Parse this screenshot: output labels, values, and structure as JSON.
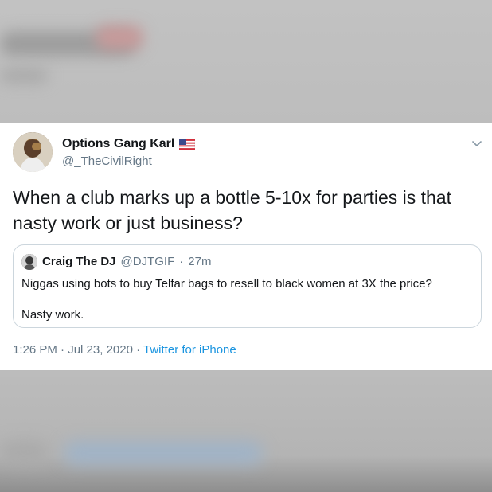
{
  "author": {
    "display_name": "Options Gang Karl",
    "handle": "@_TheCivilRight",
    "badge_icon": "us-flag-icon"
  },
  "tweet": {
    "text": "When a club marks up a bottle 5-10x for parties is that nasty work or just business?"
  },
  "quoted_tweet": {
    "display_name": "Craig The DJ",
    "handle": "@DJTGIF",
    "separator": "·",
    "time": "27m",
    "line1": "Niggas using bots to buy Telfar bags to resell to black women at 3X the price?",
    "line2": "Nasty work."
  },
  "meta": {
    "time": "1:26 PM",
    "separator1": " · ",
    "date": "Jul 23, 2020",
    "separator2": " · ",
    "source": "Twitter for iPhone"
  },
  "colors": {
    "link": "#1b95e0",
    "secondary_text": "#657786",
    "border": "#ccd6dd"
  }
}
